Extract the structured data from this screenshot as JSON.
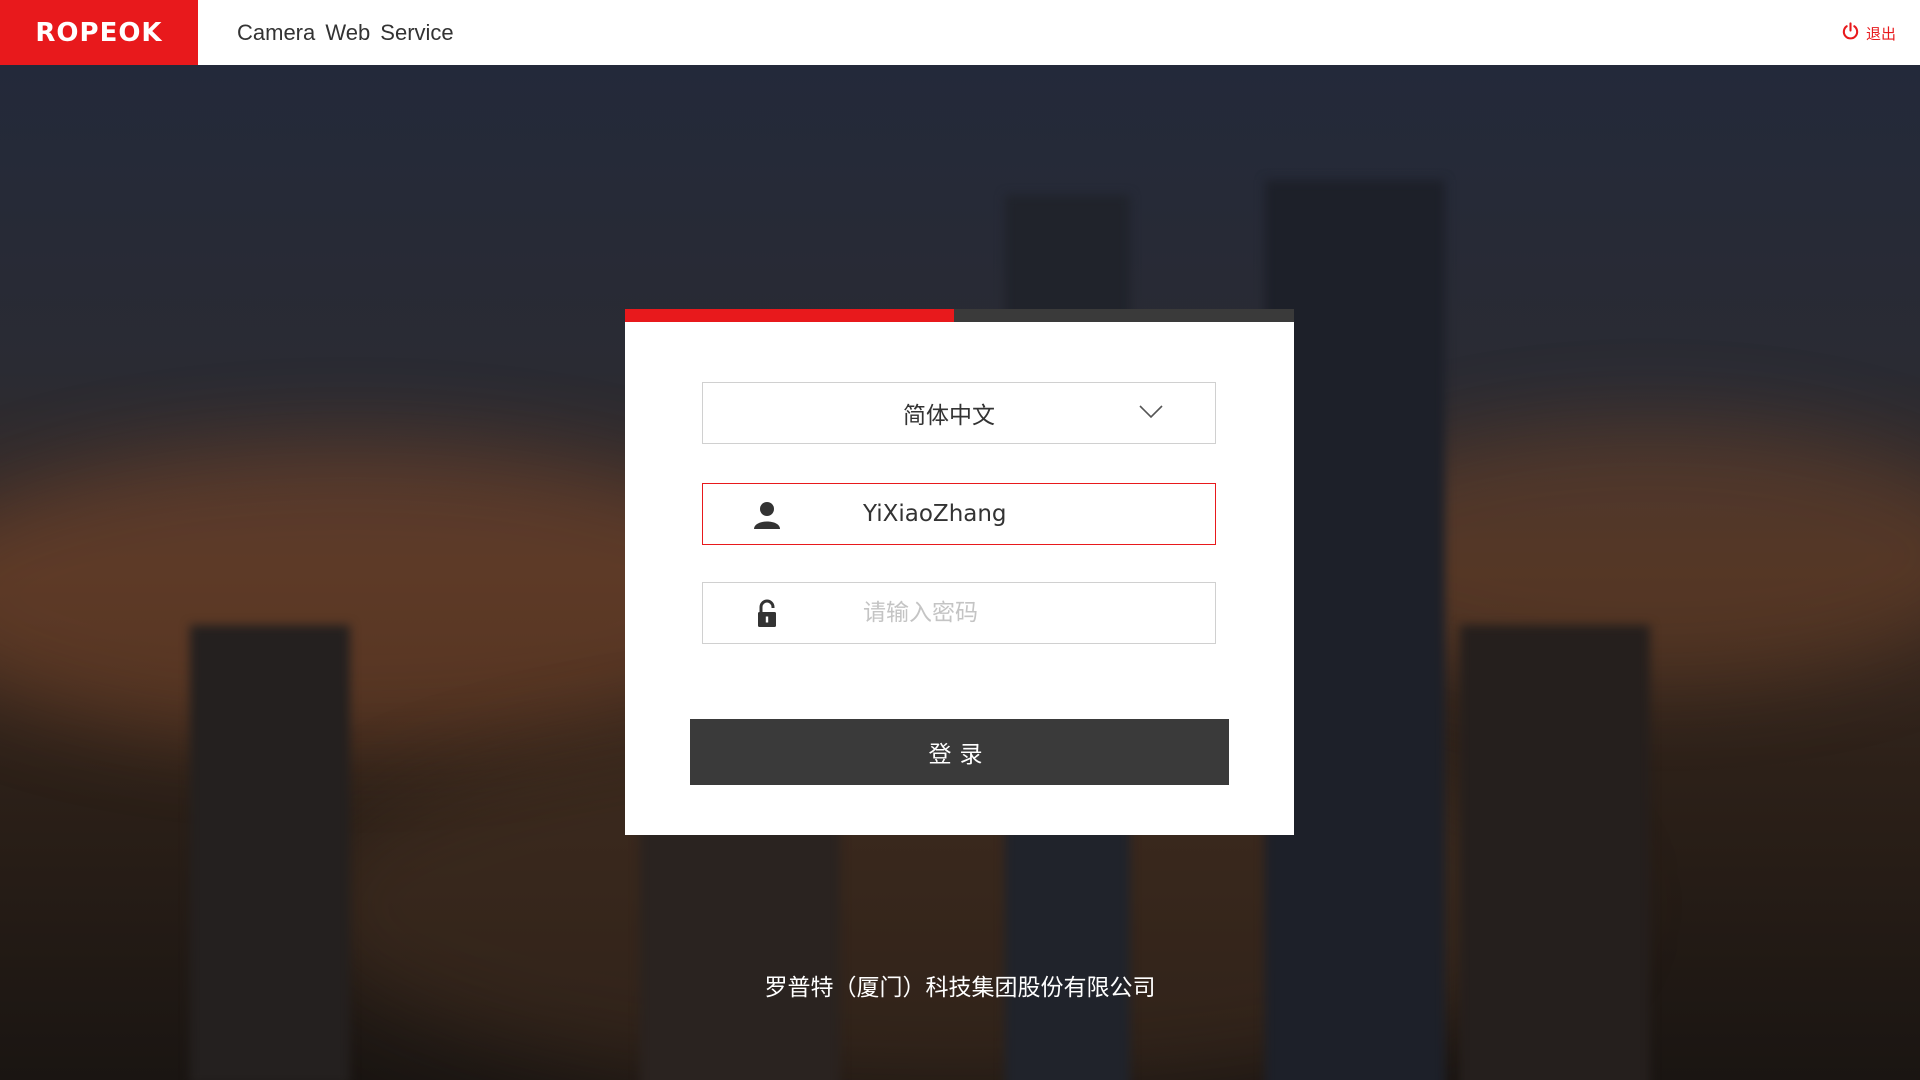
{
  "header": {
    "logo_text": "ROPEOK",
    "app_title": "Camera  Web  Service",
    "logout_label": "退出",
    "logout_icon": "power-icon"
  },
  "login": {
    "language": {
      "selected": "简体中文",
      "icon": "chevron-down-icon"
    },
    "username": {
      "value": "YiXiaoZhang",
      "icon": "user-icon"
    },
    "password": {
      "value": "",
      "placeholder": "请输入密码",
      "icon": "lock-icon"
    },
    "submit_label": "登录"
  },
  "footer": {
    "company": "罗普特（厦门）科技集团股份有限公司"
  },
  "colors": {
    "brand_red": "#e8191c",
    "dark_button": "#3a3a3a",
    "header_bg": "#ffffff"
  }
}
